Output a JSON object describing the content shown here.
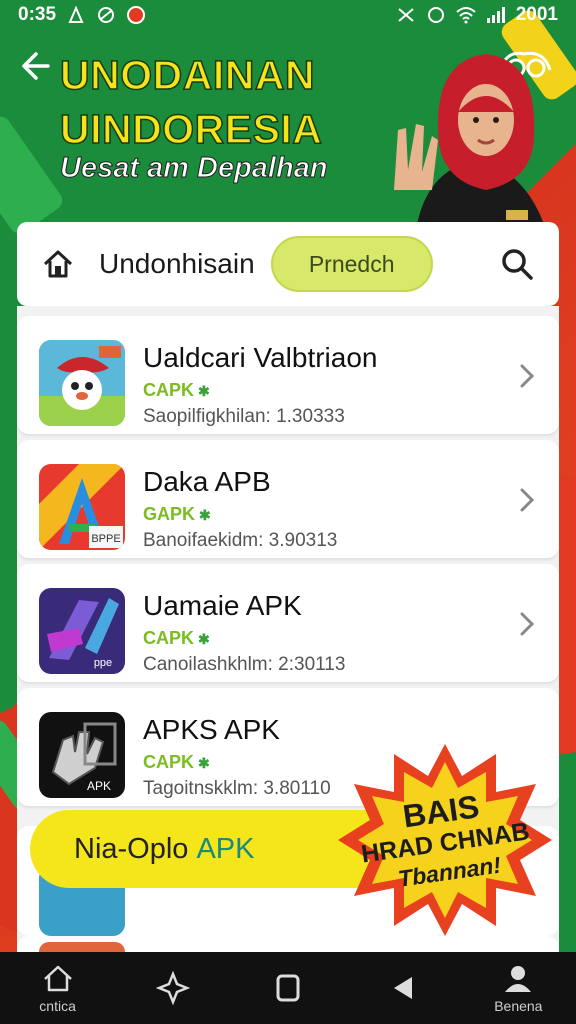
{
  "status_bar": {
    "time": "0:35",
    "battery": "2001"
  },
  "header": {
    "title_line1": "UNODAINAN",
    "title_line2": "UINDORESIA",
    "subtitle": "Uesat am Depalhan"
  },
  "search_bar": {
    "label": "Undonhisain",
    "pill": "Prnedch"
  },
  "apps": [
    {
      "name": "Ualdcari Valbtriaon",
      "tag": "CAPK",
      "meta": "Saopilfigkhilan: 1.30333",
      "icon": "apk-icon-chef"
    },
    {
      "name": "Daka APB",
      "tag": "GAPK",
      "meta": "Banoifaekidm: 3.90313",
      "icon": "apk-icon-colorful"
    },
    {
      "name": "Uamaie APK",
      "tag": "CAPK",
      "meta": "Canoilashkhlm: 2:30113",
      "icon": "apk-icon-purple"
    },
    {
      "name": "APKS APK",
      "tag": "CAPK",
      "meta": "Tagoitnskklm: 3.80110",
      "icon": "apk-icon-hand"
    }
  ],
  "cta": {
    "text": "Nia-Oplo",
    "accent": "APK"
  },
  "badge": {
    "line1": "BAIS",
    "line2": "HRAD CHNAB",
    "line3": "Tbannan!"
  },
  "nav": {
    "items": [
      {
        "label": "cntica",
        "icon": "home-icon"
      },
      {
        "label": "",
        "icon": "sparkle-icon"
      },
      {
        "label": "",
        "icon": "square-icon"
      },
      {
        "label": "",
        "icon": "back-triangle-icon"
      },
      {
        "label": "Benena",
        "icon": "person-icon"
      }
    ]
  },
  "colors": {
    "brand_green": "#1b8c3c",
    "brand_red": "#e0421f",
    "accent_yellow": "#f4e61a",
    "pill_green": "#d8e86a",
    "tag_green": "#7bbd1f"
  }
}
